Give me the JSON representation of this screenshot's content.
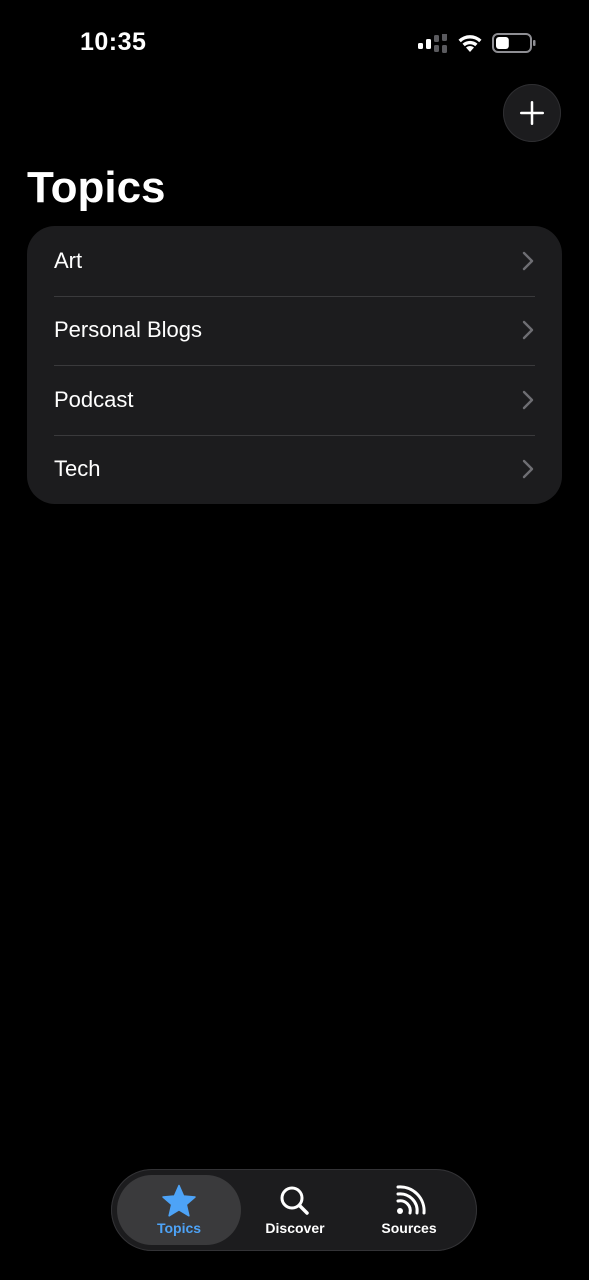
{
  "status_bar": {
    "time": "10:35",
    "battery_level": 0.4
  },
  "header": {
    "title": "Topics",
    "add_icon": "plus-icon"
  },
  "topics": [
    {
      "label": "Art"
    },
    {
      "label": "Personal Blogs"
    },
    {
      "label": "Podcast"
    },
    {
      "label": "Tech"
    }
  ],
  "tab_bar": {
    "tabs": [
      {
        "label": "Topics",
        "icon": "star-icon",
        "selected": true
      },
      {
        "label": "Discover",
        "icon": "magnifying-glass-icon",
        "selected": false
      },
      {
        "label": "Sources",
        "icon": "rss-feed-icon",
        "selected": false
      }
    ]
  },
  "colors": {
    "background": "#000000",
    "card": "#1c1c1e",
    "separator": "#3a3a3c",
    "accent": "#4da3f7",
    "chevron": "#6e6e73"
  }
}
